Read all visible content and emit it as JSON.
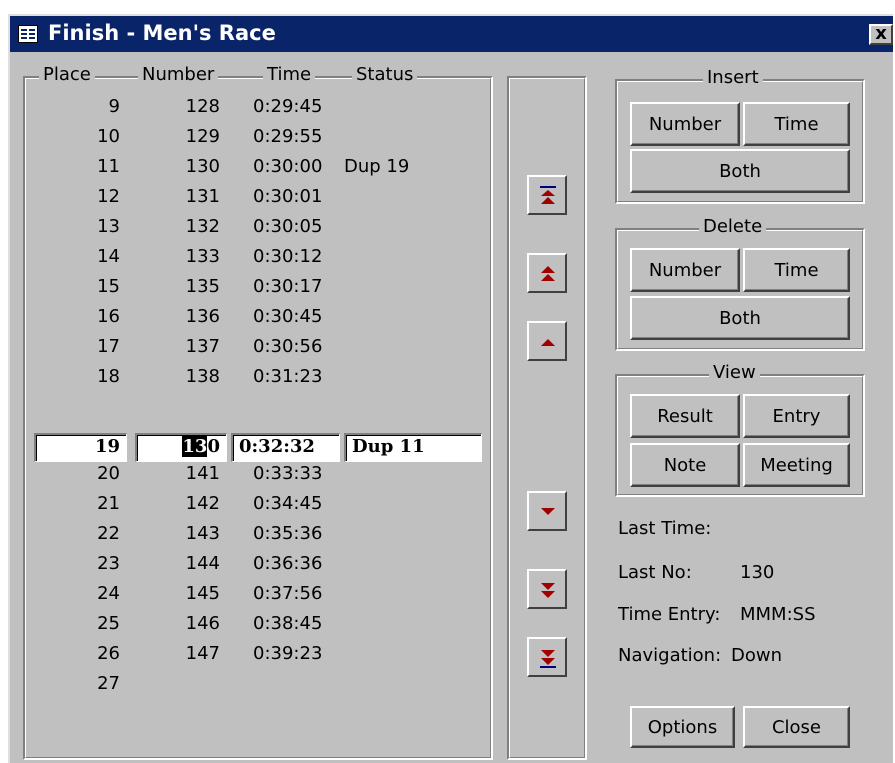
{
  "window": {
    "title": "Finish - Men's Race",
    "close_label": "x"
  },
  "results": {
    "headers": {
      "place": "Place",
      "number": "Number",
      "time": "Time",
      "status": "Status"
    },
    "rows_above": [
      {
        "place": "9",
        "number": "128",
        "time": "0:29:45",
        "status": ""
      },
      {
        "place": "10",
        "number": "129",
        "time": "0:29:55",
        "status": ""
      },
      {
        "place": "11",
        "number": "130",
        "time": "0:30:00",
        "status": "Dup 19"
      },
      {
        "place": "12",
        "number": "131",
        "time": "0:30:01",
        "status": ""
      },
      {
        "place": "13",
        "number": "132",
        "time": "0:30:05",
        "status": ""
      },
      {
        "place": "14",
        "number": "133",
        "time": "0:30:12",
        "status": ""
      },
      {
        "place": "15",
        "number": "135",
        "time": "0:30:17",
        "status": ""
      },
      {
        "place": "16",
        "number": "136",
        "time": "0:30:45",
        "status": ""
      },
      {
        "place": "17",
        "number": "137",
        "time": "0:30:56",
        "status": ""
      },
      {
        "place": "18",
        "number": "138",
        "time": "0:31:23",
        "status": ""
      }
    ],
    "current": {
      "place": "19",
      "number_selected": "13",
      "number_rest": "0",
      "time": "0:32:32",
      "status": "Dup 11"
    },
    "rows_below": [
      {
        "place": "20",
        "number": "141",
        "time": "0:33:33",
        "status": ""
      },
      {
        "place": "21",
        "number": "142",
        "time": "0:34:45",
        "status": ""
      },
      {
        "place": "22",
        "number": "143",
        "time": "0:35:36",
        "status": ""
      },
      {
        "place": "23",
        "number": "144",
        "time": "0:36:36",
        "status": ""
      },
      {
        "place": "24",
        "number": "145",
        "time": "0:37:56",
        "status": ""
      },
      {
        "place": "25",
        "number": "146",
        "time": "0:38:45",
        "status": ""
      },
      {
        "place": "26",
        "number": "147",
        "time": "0:39:23",
        "status": ""
      },
      {
        "place": "27",
        "number": "",
        "time": "",
        "status": ""
      }
    ]
  },
  "navigation_icons": [
    "first-record-icon",
    "page-up-icon",
    "previous-record-icon",
    "next-record-icon",
    "page-down-icon",
    "last-record-icon"
  ],
  "insert": {
    "title": "Insert",
    "number": "Number",
    "time": "Time",
    "both": "Both"
  },
  "delete": {
    "title": "Delete",
    "number": "Number",
    "time": "Time",
    "both": "Both"
  },
  "view": {
    "title": "View",
    "result": "Result",
    "entry": "Entry",
    "note": "Note",
    "meeting": "Meeting"
  },
  "info": {
    "last_time_label": "Last Time:",
    "last_time_value": "",
    "last_no_label": "Last No:",
    "last_no_value": "130",
    "time_entry_label": "Time Entry:",
    "time_entry_value": "MMM:SS",
    "navigation_label": "Navigation:",
    "navigation_value": "Down"
  },
  "footer": {
    "options": "Options",
    "close": "Close"
  },
  "colors": {
    "titlebar": "#0a246a",
    "face": "#c0c0c0",
    "arrow": "#a00000",
    "bar": "#000080"
  }
}
